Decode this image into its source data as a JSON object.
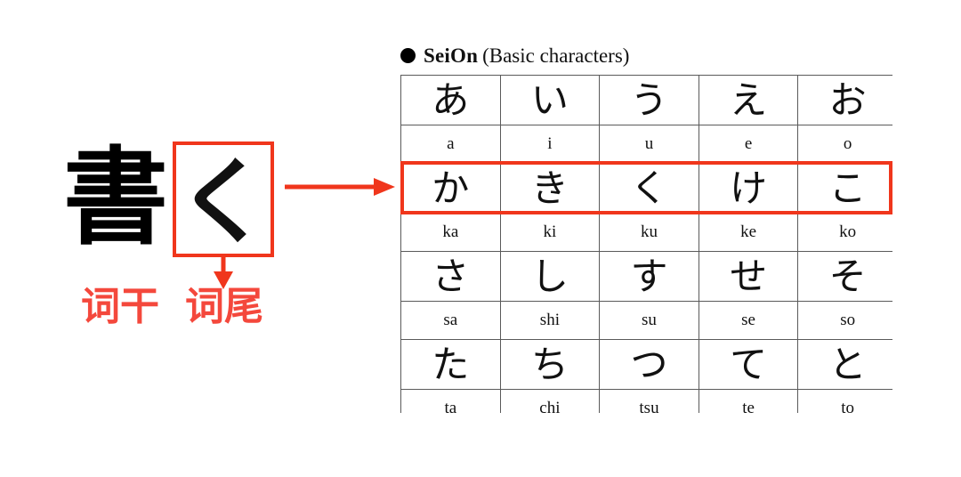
{
  "diagram": {
    "stem_character": "書",
    "ending_character": "く",
    "stem_label": "词干",
    "ending_label": "词尾",
    "accent_color": "#F0361C",
    "label_color": "#F4483C",
    "link_arrow_icon": "arrow-right-icon",
    "down_arrow_icon": "arrow-down-icon"
  },
  "chart": {
    "bullet_icon": "filled-circle-bullet",
    "title_main": "SeiOn",
    "title_sub": "(Basic characters)",
    "highlighted_row_index": 1,
    "rows": [
      {
        "kana": [
          "あ",
          "い",
          "う",
          "え",
          "お"
        ],
        "romaji": [
          "a",
          "i",
          "u",
          "e",
          "o"
        ]
      },
      {
        "kana": [
          "か",
          "き",
          "く",
          "け",
          "こ"
        ],
        "romaji": [
          "ka",
          "ki",
          "ku",
          "ke",
          "ko"
        ]
      },
      {
        "kana": [
          "さ",
          "し",
          "す",
          "せ",
          "そ"
        ],
        "romaji": [
          "sa",
          "shi",
          "su",
          "se",
          "so"
        ]
      },
      {
        "kana": [
          "た",
          "ち",
          "つ",
          "て",
          "と"
        ],
        "romaji": [
          "ta",
          "chi",
          "tsu",
          "te",
          "to"
        ]
      }
    ]
  }
}
